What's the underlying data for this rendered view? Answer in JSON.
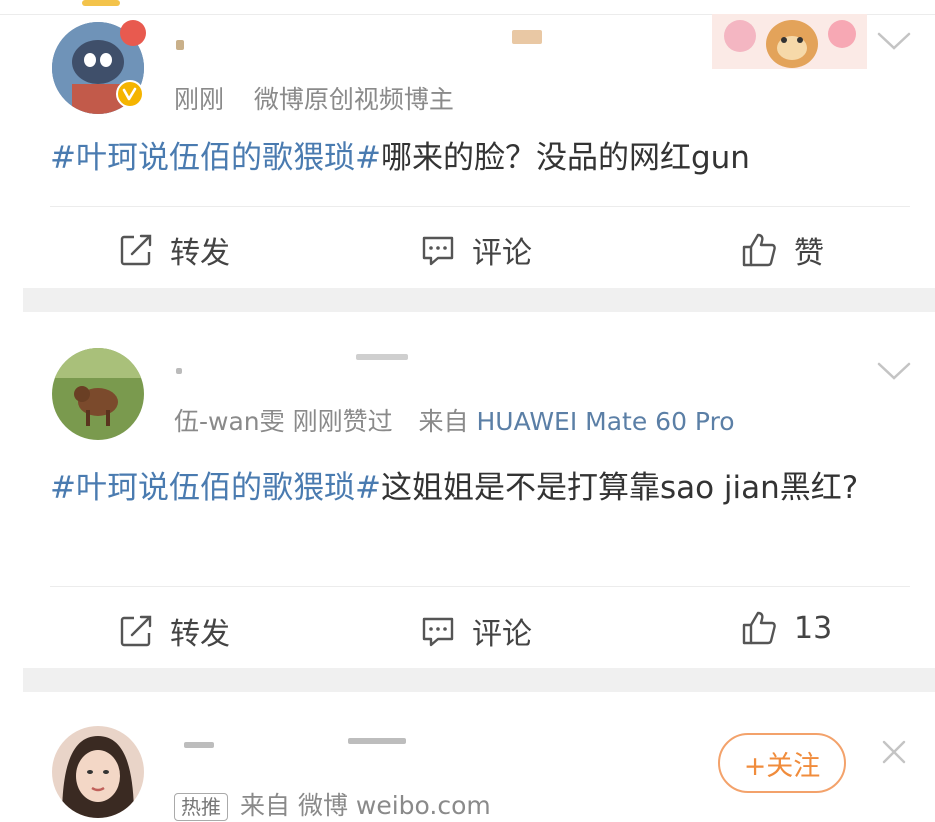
{
  "posts": [
    {
      "meta": {
        "time": "刚刚",
        "source": "微博原创视频博主"
      },
      "topic": "#叶珂说伍佰的歌猥琐#",
      "text": "哪来的脸？没品的网红gun",
      "actions": {
        "repost": "转发",
        "comment": "评论",
        "like": "赞"
      }
    },
    {
      "meta": {
        "author_prefix": "伍-wan雯",
        "time": "刚刚赞过",
        "from_label": "来自",
        "source": "HUAWEI Mate 60 Pro"
      },
      "topic": "#叶珂说伍佰的歌猥琐#",
      "text": "这姐姐是不是打算靠sao jian黑红?",
      "actions": {
        "repost": "转发",
        "comment": "评论",
        "like": "13"
      }
    },
    {
      "meta": {
        "tag": "热推",
        "source": "来自 微博 weibo.com"
      },
      "follow_label": "+关注"
    }
  ],
  "colors": {
    "topic": "#4a7bb0",
    "meta": "#8a8a8a",
    "follow": "#f08c3c",
    "verified_badge": "#f5b400",
    "separator": "#f0f0f0"
  },
  "icons": [
    "repost-icon",
    "comment-icon",
    "like-icon",
    "chevron-down-icon",
    "close-icon",
    "verified-badge-icon"
  ]
}
